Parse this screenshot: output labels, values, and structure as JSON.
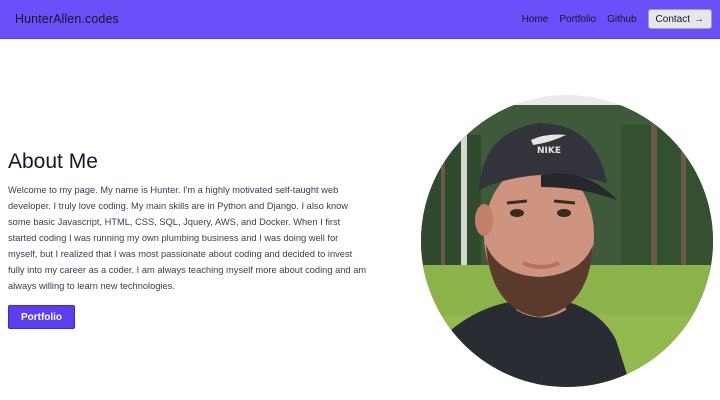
{
  "nav": {
    "brand": "HunterAllen.codes",
    "links": [
      "Home",
      "Portfolio",
      "Github"
    ],
    "contact_label": "Contact",
    "contact_icon": "arrow-right-icon",
    "background_color": "#6b4ff8"
  },
  "about": {
    "title": "About Me",
    "paragraph": "Welcome to my page. My name is Hunter. I'm a highly motivated self-taught web developer. I truly love coding. My main skills are in Python and Django. I also know some basic Javascript, HTML, CSS, SQL, Jquery, AWS, and Docker. When I first started coding I was running my own plumbing business and I was doing well for myself, but I realized that I was most passionate about coding and decided to invest fully into my career as a coder. I am always teaching myself more about coding and am always willing to learn new technologies.",
    "button_label": "Portfolio",
    "button_color": "#5b3ef0"
  },
  "profile_photo": {
    "subject": "profile-photo",
    "cap_logo": "NIKE"
  }
}
